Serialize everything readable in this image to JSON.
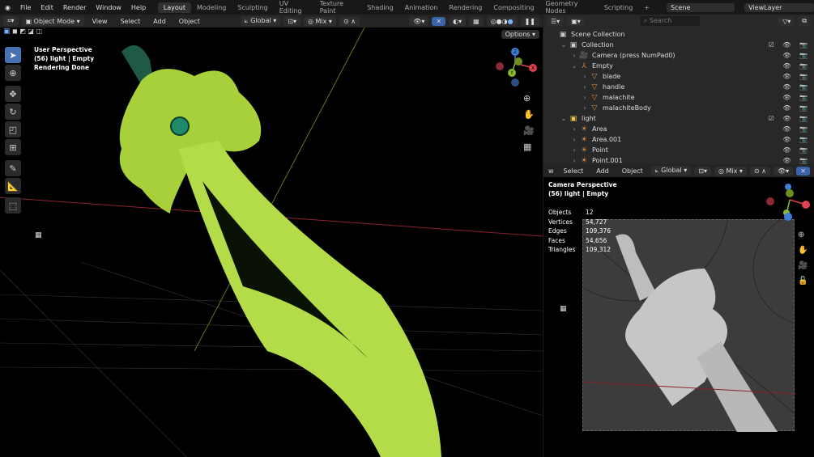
{
  "topbar": {
    "menus": [
      "File",
      "Edit",
      "Render",
      "Window",
      "Help"
    ],
    "workspaces": [
      "Layout",
      "Modeling",
      "Sculpting",
      "UV Editing",
      "Texture Paint",
      "Shading",
      "Animation",
      "Rendering",
      "Compositing",
      "Geometry Nodes",
      "Scripting"
    ],
    "active_workspace": "Layout",
    "add_workspace": "+",
    "scene": "Scene",
    "view_layer": "ViewLayer"
  },
  "viewport_header": {
    "mode": "Object Mode",
    "menus": [
      "View",
      "Select",
      "Add",
      "Object"
    ],
    "orientation": "Global",
    "snap": "Mix",
    "options": "Options"
  },
  "viewport": {
    "view_name": "User Perspective",
    "collection_info": "(56) light | Empty",
    "status": "Rendering Done"
  },
  "outliner": {
    "search_placeholder": "Search",
    "items": [
      {
        "label": "Scene Collection",
        "depth": 0,
        "icon": "collection-icon"
      },
      {
        "label": "Collection",
        "depth": 1,
        "icon": "collection-icon",
        "expanded": true
      },
      {
        "label": "Camera (press NumPad0)",
        "depth": 2,
        "icon": "camera-icon"
      },
      {
        "label": "Empty",
        "depth": 2,
        "icon": "empty-icon",
        "expanded": true
      },
      {
        "label": "blade",
        "depth": 3,
        "icon": "mesh-icon"
      },
      {
        "label": "handle",
        "depth": 3,
        "icon": "mesh-icon"
      },
      {
        "label": "malachite",
        "depth": 3,
        "icon": "mesh-icon"
      },
      {
        "label": "malachiteBody",
        "depth": 3,
        "icon": "mesh-icon"
      },
      {
        "label": "light",
        "depth": 1,
        "icon": "collection-icon",
        "expanded": true
      },
      {
        "label": "Area",
        "depth": 2,
        "icon": "light-icon"
      },
      {
        "label": "Area.001",
        "depth": 2,
        "icon": "light-icon"
      },
      {
        "label": "Point",
        "depth": 2,
        "icon": "light-icon"
      },
      {
        "label": "Point.001",
        "depth": 2,
        "icon": "light-icon"
      }
    ]
  },
  "camera_viewport": {
    "menus": [
      "w",
      "Select",
      "Add",
      "Object"
    ],
    "orientation": "Global",
    "snap": "Mix",
    "view_name": "Camera Perspective",
    "collection_info": "(56) light | Empty",
    "stats": [
      {
        "label": "Objects",
        "value": "12"
      },
      {
        "label": "Vertices",
        "value": "54,727"
      },
      {
        "label": "Edges",
        "value": "109,376"
      },
      {
        "label": "Faces",
        "value": "54,656"
      },
      {
        "label": "Triangles",
        "value": "109,312"
      }
    ]
  },
  "gizmo": {
    "x": "X",
    "y": "Y",
    "z": "Z"
  },
  "colors": {
    "accent": "#4772b3",
    "blade": "#a8d43a",
    "x_axis": "#e0404f",
    "y_axis": "#8ab92d",
    "z_axis": "#3d7fd6"
  }
}
